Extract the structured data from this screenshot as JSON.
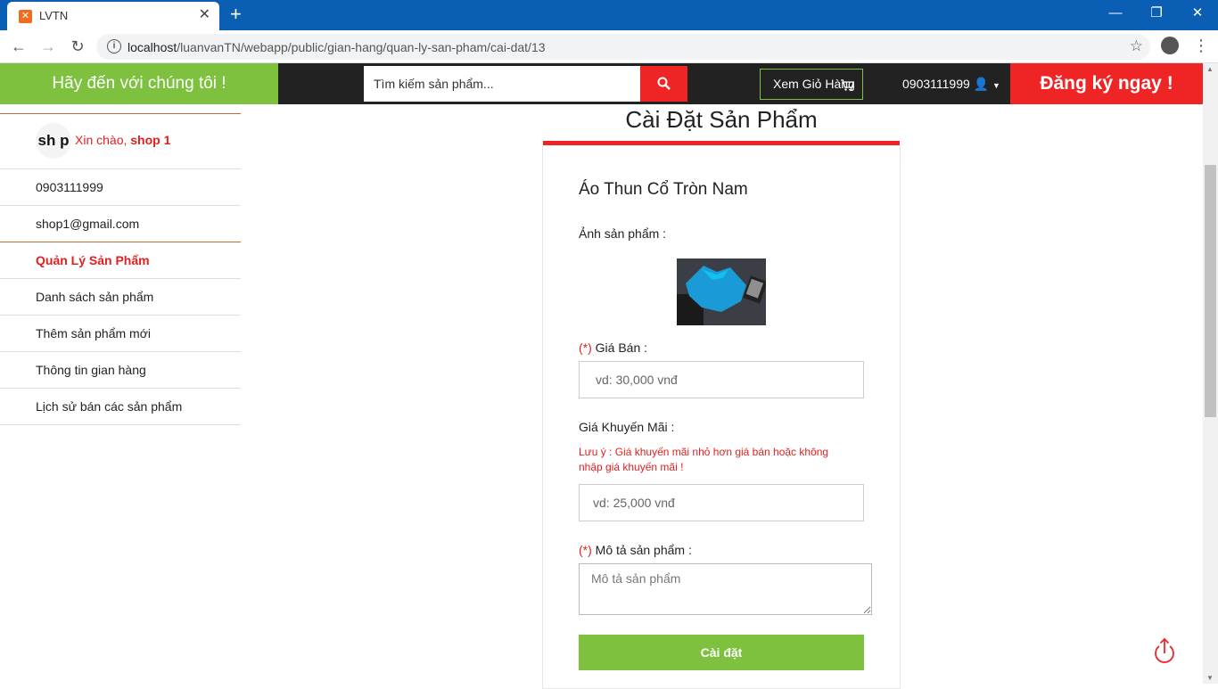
{
  "browser": {
    "tab_title": "LVTN",
    "tab_close": "✕",
    "new_tab": "+",
    "url_host": "localhost",
    "url_path": "/luanvanTN/webapp/public/gian-hang/quan-ly-san-pham/cai-dat/13",
    "window_controls": [
      "—",
      "❐",
      "✕"
    ]
  },
  "header": {
    "greeting": "Hãy đến với chúng tôi !",
    "search_placeholder": "Tìm kiếm sản phẩm...",
    "cart_label": "Xem Giỏ Hàng",
    "phone": "0903111999",
    "register_label": "Đăng ký ngay !"
  },
  "sidebar": {
    "avatar_text": "sh p",
    "greeting_prefix": "Xin chào, ",
    "shop_name": "shop 1",
    "phone": "0903111999",
    "email": "shop1@gmail.com",
    "section_title": "Quản Lý Sản Phẩm",
    "items": [
      {
        "label": "Danh sách sản phẩm"
      },
      {
        "label": "Thêm sản phẩm mới"
      },
      {
        "label": "Thông tin gian hàng"
      },
      {
        "label": "Lịch sử bán các sản phẩm"
      }
    ]
  },
  "form": {
    "page_title": "Cài Đặt Sản Phẩm",
    "product_name": "Áo Thun Cổ Tròn Nam",
    "image_label": "Ảnh sản phẩm :",
    "required_mark": "(*)",
    "price_label": " Giá Bán :",
    "price_placeholder": "vd: 30,000 vnđ",
    "promo_label": "Giá Khuyến Mãi :",
    "promo_note": "Lưu ý : Giá khuyến mãi nhỏ hơn giá bán hoặc không nhập giá khuyến mãi !",
    "promo_placeholder": "vd: 25,000 vnđ",
    "desc_label": " Mô tả sản phẩm :",
    "desc_placeholder": "Mô tả sản phẩm",
    "submit_label": "Cài đặt"
  },
  "colors": {
    "green": "#7dc13f",
    "red": "#ef2525",
    "dark": "#222222",
    "browser_blue": "#0a5fb4"
  }
}
